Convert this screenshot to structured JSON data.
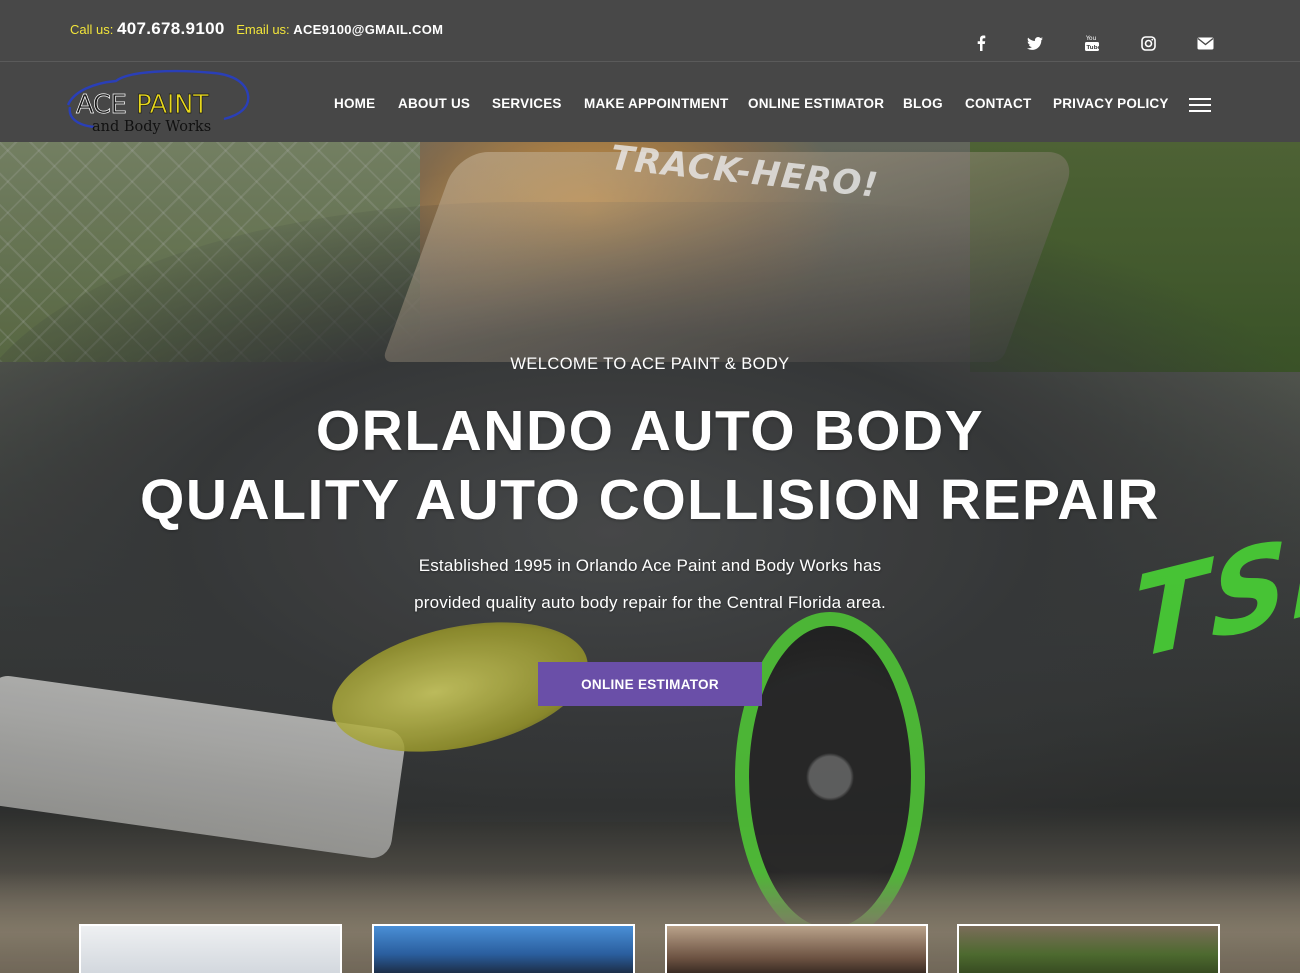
{
  "topbar": {
    "call_label": "Call us:",
    "phone": "407.678.9100",
    "email_label": "Email us:",
    "email": "ACE9100@GMAIL.COM",
    "social": [
      {
        "icon": "facebook-icon"
      },
      {
        "icon": "twitter-icon"
      },
      {
        "icon": "youtube-icon",
        "text": "You Tube"
      },
      {
        "icon": "instagram-icon"
      },
      {
        "icon": "email-icon"
      }
    ]
  },
  "logo": {
    "line1_a": "ACE",
    "line1_b": "PAINT",
    "line2": "and Body Works"
  },
  "nav": {
    "items": [
      "HOME",
      "ABOUT US",
      "SERVICES",
      "MAKE APPOINTMENT",
      "ONLINE ESTIMATOR",
      "BLOG",
      "CONTACT",
      "PRIVACY POLICY"
    ],
    "menu_icon": "hamburger-menu-icon"
  },
  "hero": {
    "windshield_text": "TRACK-HERO!",
    "side_text": "TSM",
    "welcome": "WELCOME TO ACE PAINT & BODY",
    "title_line1": "ORLANDO AUTO BODY",
    "title_line2": "QUALITY AUTO COLLISION REPAIR",
    "desc_line1": "Established 1995 in Orlando Ace Paint and Body Works has",
    "desc_line2": "provided quality auto body repair for the Central Florida area.",
    "cta": "ONLINE ESTIMATOR"
  },
  "colors": {
    "topbar_bg": "#484848",
    "accent_yellow": "#f2e53a",
    "cta_purple": "#6a4fa8"
  }
}
